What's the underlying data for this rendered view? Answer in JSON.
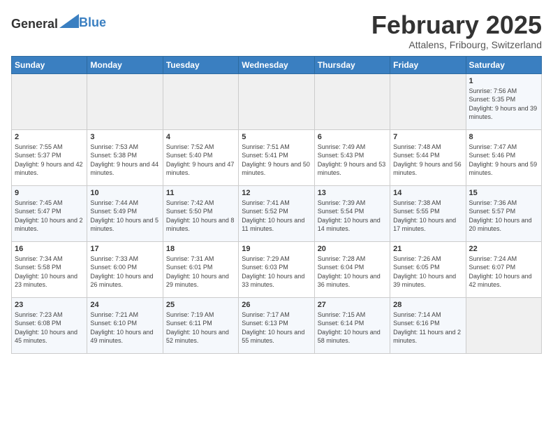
{
  "header": {
    "logo_general": "General",
    "logo_blue": "Blue",
    "month_title": "February 2025",
    "subtitle": "Attalens, Fribourg, Switzerland"
  },
  "weekdays": [
    "Sunday",
    "Monday",
    "Tuesday",
    "Wednesday",
    "Thursday",
    "Friday",
    "Saturday"
  ],
  "weeks": [
    [
      {
        "day": "",
        "info": ""
      },
      {
        "day": "",
        "info": ""
      },
      {
        "day": "",
        "info": ""
      },
      {
        "day": "",
        "info": ""
      },
      {
        "day": "",
        "info": ""
      },
      {
        "day": "",
        "info": ""
      },
      {
        "day": "1",
        "info": "Sunrise: 7:56 AM\nSunset: 5:35 PM\nDaylight: 9 hours and 39 minutes."
      }
    ],
    [
      {
        "day": "2",
        "info": "Sunrise: 7:55 AM\nSunset: 5:37 PM\nDaylight: 9 hours and 42 minutes."
      },
      {
        "day": "3",
        "info": "Sunrise: 7:53 AM\nSunset: 5:38 PM\nDaylight: 9 hours and 44 minutes."
      },
      {
        "day": "4",
        "info": "Sunrise: 7:52 AM\nSunset: 5:40 PM\nDaylight: 9 hours and 47 minutes."
      },
      {
        "day": "5",
        "info": "Sunrise: 7:51 AM\nSunset: 5:41 PM\nDaylight: 9 hours and 50 minutes."
      },
      {
        "day": "6",
        "info": "Sunrise: 7:49 AM\nSunset: 5:43 PM\nDaylight: 9 hours and 53 minutes."
      },
      {
        "day": "7",
        "info": "Sunrise: 7:48 AM\nSunset: 5:44 PM\nDaylight: 9 hours and 56 minutes."
      },
      {
        "day": "8",
        "info": "Sunrise: 7:47 AM\nSunset: 5:46 PM\nDaylight: 9 hours and 59 minutes."
      }
    ],
    [
      {
        "day": "9",
        "info": "Sunrise: 7:45 AM\nSunset: 5:47 PM\nDaylight: 10 hours and 2 minutes."
      },
      {
        "day": "10",
        "info": "Sunrise: 7:44 AM\nSunset: 5:49 PM\nDaylight: 10 hours and 5 minutes."
      },
      {
        "day": "11",
        "info": "Sunrise: 7:42 AM\nSunset: 5:50 PM\nDaylight: 10 hours and 8 minutes."
      },
      {
        "day": "12",
        "info": "Sunrise: 7:41 AM\nSunset: 5:52 PM\nDaylight: 10 hours and 11 minutes."
      },
      {
        "day": "13",
        "info": "Sunrise: 7:39 AM\nSunset: 5:54 PM\nDaylight: 10 hours and 14 minutes."
      },
      {
        "day": "14",
        "info": "Sunrise: 7:38 AM\nSunset: 5:55 PM\nDaylight: 10 hours and 17 minutes."
      },
      {
        "day": "15",
        "info": "Sunrise: 7:36 AM\nSunset: 5:57 PM\nDaylight: 10 hours and 20 minutes."
      }
    ],
    [
      {
        "day": "16",
        "info": "Sunrise: 7:34 AM\nSunset: 5:58 PM\nDaylight: 10 hours and 23 minutes."
      },
      {
        "day": "17",
        "info": "Sunrise: 7:33 AM\nSunset: 6:00 PM\nDaylight: 10 hours and 26 minutes."
      },
      {
        "day": "18",
        "info": "Sunrise: 7:31 AM\nSunset: 6:01 PM\nDaylight: 10 hours and 29 minutes."
      },
      {
        "day": "19",
        "info": "Sunrise: 7:29 AM\nSunset: 6:03 PM\nDaylight: 10 hours and 33 minutes."
      },
      {
        "day": "20",
        "info": "Sunrise: 7:28 AM\nSunset: 6:04 PM\nDaylight: 10 hours and 36 minutes."
      },
      {
        "day": "21",
        "info": "Sunrise: 7:26 AM\nSunset: 6:05 PM\nDaylight: 10 hours and 39 minutes."
      },
      {
        "day": "22",
        "info": "Sunrise: 7:24 AM\nSunset: 6:07 PM\nDaylight: 10 hours and 42 minutes."
      }
    ],
    [
      {
        "day": "23",
        "info": "Sunrise: 7:23 AM\nSunset: 6:08 PM\nDaylight: 10 hours and 45 minutes."
      },
      {
        "day": "24",
        "info": "Sunrise: 7:21 AM\nSunset: 6:10 PM\nDaylight: 10 hours and 49 minutes."
      },
      {
        "day": "25",
        "info": "Sunrise: 7:19 AM\nSunset: 6:11 PM\nDaylight: 10 hours and 52 minutes."
      },
      {
        "day": "26",
        "info": "Sunrise: 7:17 AM\nSunset: 6:13 PM\nDaylight: 10 hours and 55 minutes."
      },
      {
        "day": "27",
        "info": "Sunrise: 7:15 AM\nSunset: 6:14 PM\nDaylight: 10 hours and 58 minutes."
      },
      {
        "day": "28",
        "info": "Sunrise: 7:14 AM\nSunset: 6:16 PM\nDaylight: 11 hours and 2 minutes."
      },
      {
        "day": "",
        "info": ""
      }
    ]
  ]
}
